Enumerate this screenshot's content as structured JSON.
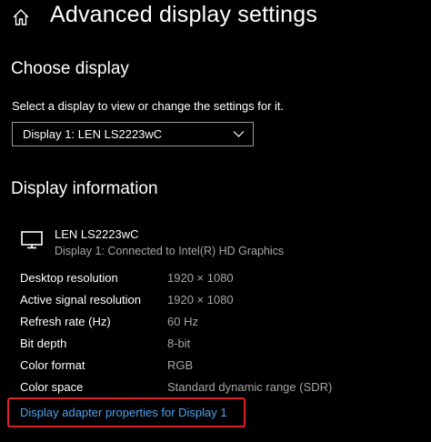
{
  "header": {
    "title": "Advanced display settings",
    "home_icon": "home-icon"
  },
  "choose_display": {
    "heading": "Choose display",
    "description": "Select a display to view or change the settings for it.",
    "selected_display": "Display 1: LEN LS2223wC"
  },
  "display_information": {
    "heading": "Display information",
    "monitor": {
      "name": "LEN LS2223wC",
      "connection": "Display 1: Connected to Intel(R) HD Graphics"
    },
    "rows": [
      {
        "label": "Desktop resolution",
        "value": "1920 × 1080"
      },
      {
        "label": "Active signal resolution",
        "value": "1920 × 1080"
      },
      {
        "label": "Refresh rate (Hz)",
        "value": "60 Hz"
      },
      {
        "label": "Bit depth",
        "value": "8-bit"
      },
      {
        "label": "Color format",
        "value": "RGB"
      },
      {
        "label": "Color space",
        "value": "Standard dynamic range (SDR)"
      }
    ],
    "adapter_link": "Display adapter properties for Display 1"
  },
  "colors": {
    "background": "#000000",
    "text": "#ffffff",
    "secondary_text": "#a6a6a6",
    "link": "#4ea2ef",
    "highlight_border": "#e0202a"
  }
}
